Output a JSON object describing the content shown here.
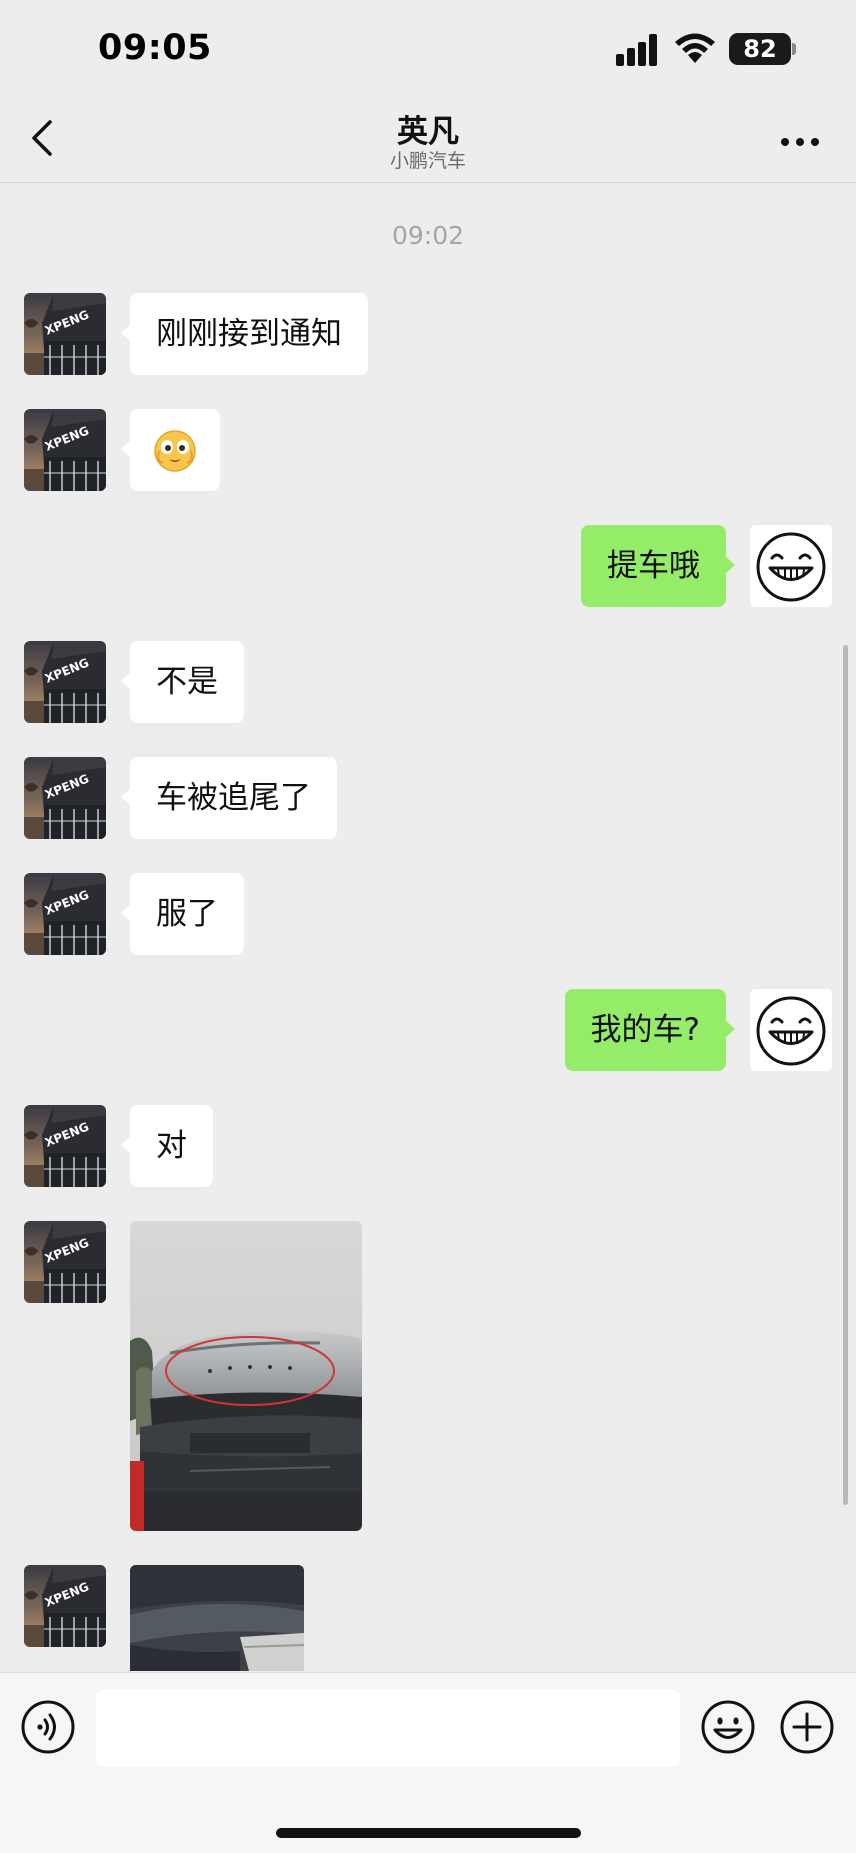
{
  "status_bar": {
    "time": "09:05",
    "battery": "82"
  },
  "header": {
    "title": "英凡",
    "subtitle": "小鹏汽车",
    "back_icon": "chevron-left-icon",
    "more_icon": "more-dots-icon"
  },
  "chat": {
    "timestamp": "09:02",
    "messages": [
      {
        "from": "contact",
        "type": "text",
        "text": "刚刚接到通知"
      },
      {
        "from": "contact",
        "type": "emoji",
        "icon": "surprised-face-emoji-icon"
      },
      {
        "from": "me",
        "type": "text",
        "text": "提车哦"
      },
      {
        "from": "contact",
        "type": "text",
        "text": "不是"
      },
      {
        "from": "contact",
        "type": "text",
        "text": "车被追尾了"
      },
      {
        "from": "contact",
        "type": "text",
        "text": "服了"
      },
      {
        "from": "me",
        "type": "text",
        "text": "我的车?"
      },
      {
        "from": "contact",
        "type": "text",
        "text": "对"
      },
      {
        "from": "contact",
        "type": "image",
        "description": "car-rear-photo"
      },
      {
        "from": "contact",
        "type": "image",
        "description": "car-rear-photo-partial"
      }
    ]
  },
  "input_bar": {
    "text_value": "",
    "voice_icon": "voice-icon",
    "emoji_icon": "smiley-icon",
    "plus_icon": "plus-icon"
  },
  "colors": {
    "background": "#ededed",
    "incoming_bubble": "#ffffff",
    "outgoing_bubble": "#95ec69",
    "timestamp": "#a5a5a5",
    "input_bar": "#f6f6f6"
  }
}
